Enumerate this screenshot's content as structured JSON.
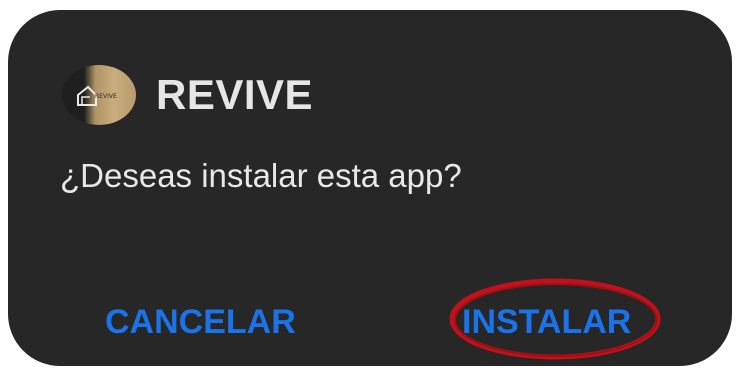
{
  "dialog": {
    "app_name": "REVIVE",
    "app_icon": "revive-logo-icon",
    "icon_text": "REVIVE",
    "prompt": "¿Deseas instalar esta app?",
    "cancel_label": "CANCELAR",
    "install_label": "INSTALAR"
  },
  "colors": {
    "dialog_background": "#272727",
    "button_text": "#1a73e8",
    "highlight_ring": "#c0121b",
    "icon_gold": "#c9ad7c"
  }
}
